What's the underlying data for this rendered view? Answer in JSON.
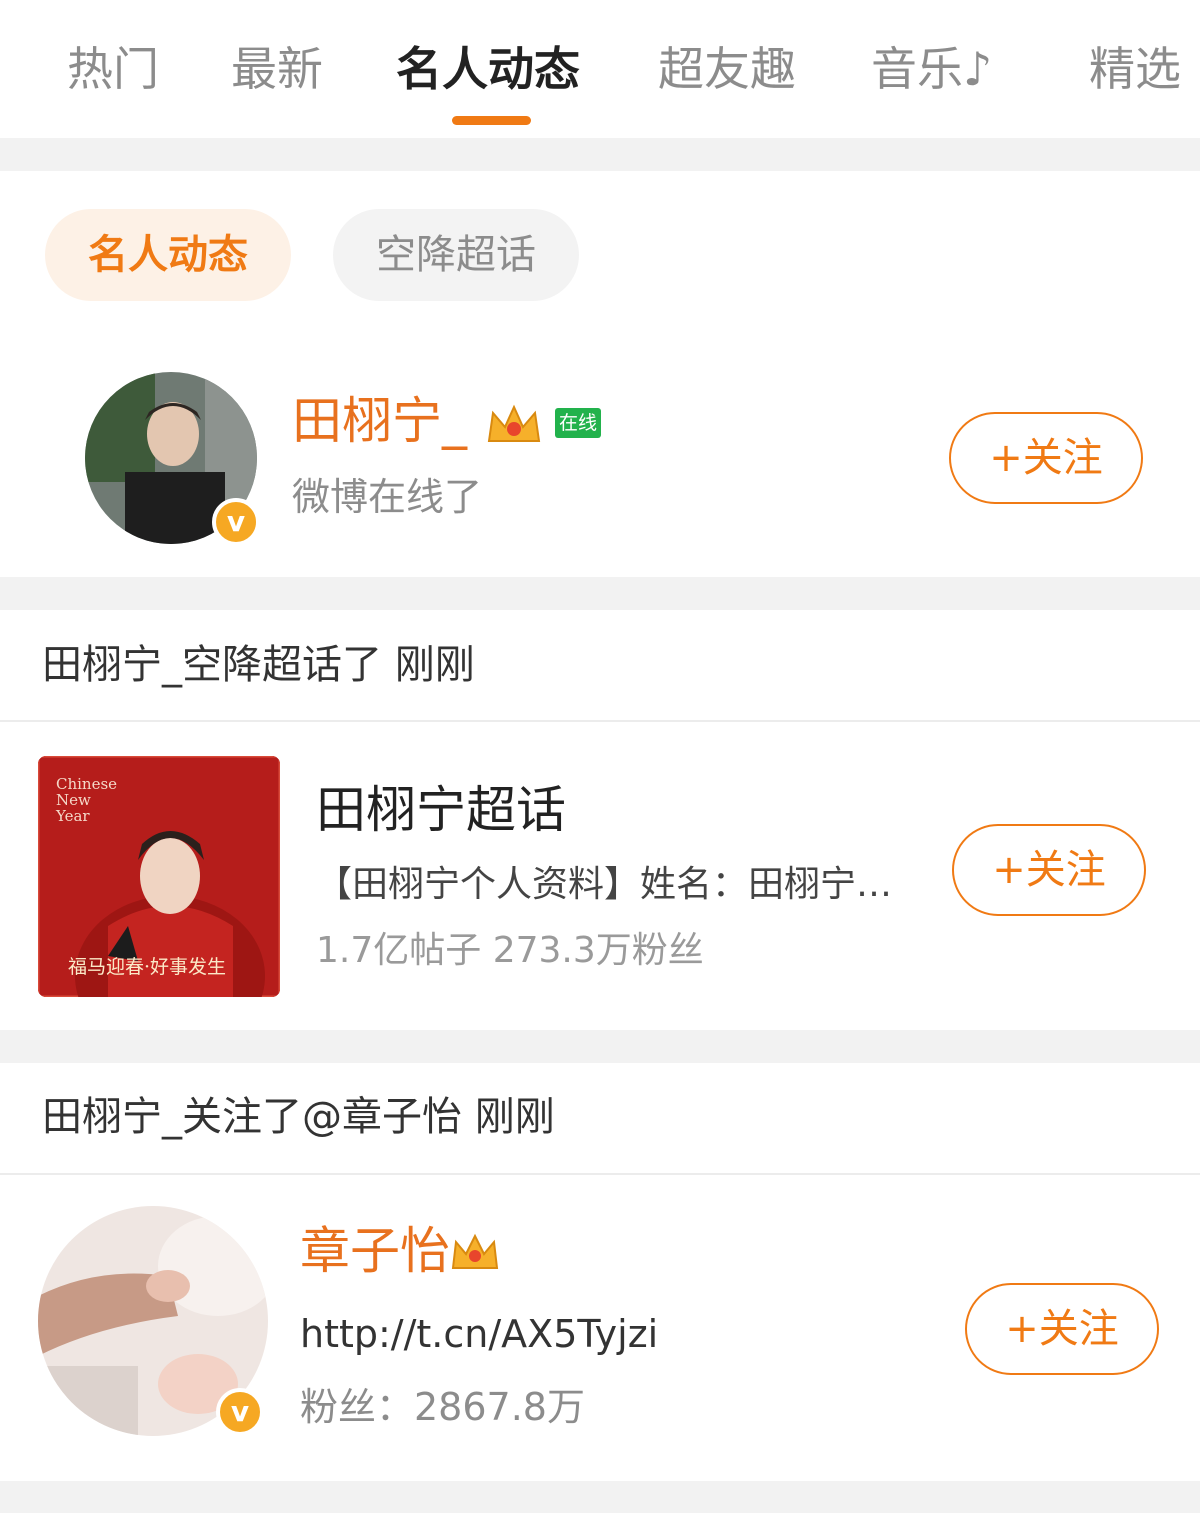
{
  "top_tabs": [
    {
      "label": "热门"
    },
    {
      "label": "最新"
    },
    {
      "label": "名人动态"
    },
    {
      "label": "超友趣"
    },
    {
      "label": "音乐♪"
    },
    {
      "label": "精选"
    }
  ],
  "filter_pills": [
    {
      "label": "名人动态"
    },
    {
      "label": "空降超话"
    }
  ],
  "user_card": {
    "name": "田栩宁_",
    "status_badge": "在线",
    "subtitle": "微博在线了",
    "follow_label": "+关注"
  },
  "activity1": {
    "text": "田栩宁_空降超话了 刚刚"
  },
  "supertopic_card": {
    "image_text_top": "Chinese New Year",
    "image_text_bottom": "福马迎春·好事发生",
    "title": "田栩宁超话",
    "description": "【田栩宁个人资料】姓名：田栩宁…",
    "stats": "1.7亿帖子  273.3万粉丝",
    "follow_label": "+关注"
  },
  "activity2": {
    "text": "田栩宁_关注了@章子怡 刚刚"
  },
  "user_card2": {
    "name": "章子怡",
    "url": "http://t.cn/AX5Tyjzi",
    "fans": "粉丝：2867.8万",
    "follow_label": "+关注"
  },
  "colors": {
    "accent": "#f07a14",
    "name": "#e8711e",
    "online": "#22b24c"
  }
}
